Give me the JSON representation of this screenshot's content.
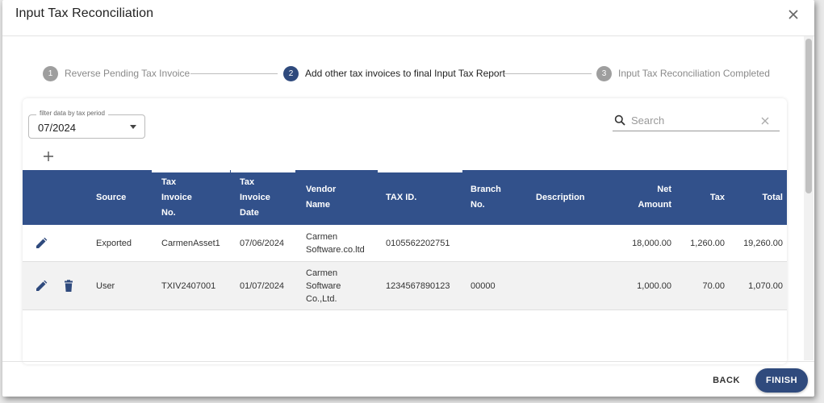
{
  "dialog": {
    "title": "Input Tax Reconciliation",
    "close_icon": "close-icon"
  },
  "stepper": {
    "steps": [
      {
        "number": "1",
        "label": "Reverse Pending Tax Invoice",
        "active": false
      },
      {
        "number": "2",
        "label": "Add other tax invoices to final Input Tax Report",
        "active": true
      },
      {
        "number": "3",
        "label": "Input Tax Reconciliation Completed",
        "active": false
      }
    ]
  },
  "filter": {
    "legend": "filter data by tax period",
    "value": "07/2024"
  },
  "search": {
    "placeholder": "Search",
    "value": ""
  },
  "table": {
    "headers": {
      "source": "Source",
      "tax_invoice_no": "Tax Invoice No.",
      "tax_invoice_date": "Tax Invoice Date",
      "vendor_name": "Vendor Name",
      "tax_id": "TAX ID.",
      "branch_no": "Branch No.",
      "description": "Description",
      "net_amount": "Net Amount",
      "tax": "Tax",
      "total": "Total"
    },
    "rows": [
      {
        "source": "Exported",
        "tax_invoice_no": "CarmenAsset1",
        "tax_invoice_date": "07/06/2024",
        "vendor_name": "Carmen Software.co.ltd",
        "tax_id": "0105562202751",
        "branch_no": "",
        "description": "",
        "net_amount": "18,000.00",
        "tax": "1,260.00",
        "total": "19,260.00"
      },
      {
        "source": "User",
        "tax_invoice_no": "TXIV2407001",
        "tax_invoice_date": "01/07/2024",
        "vendor_name": "Carmen Software Co.,Ltd.",
        "tax_id": "1234567890123",
        "branch_no": "00000",
        "description": "",
        "net_amount": "1,000.00",
        "tax": "70.00",
        "total": "1,070.00"
      }
    ]
  },
  "footer": {
    "back_label": "BACK",
    "finish_label": "FINISH"
  },
  "colors": {
    "primary": "#2f4a7d",
    "table_header": "#32518b",
    "step_inactive": "#9e9e9e"
  }
}
